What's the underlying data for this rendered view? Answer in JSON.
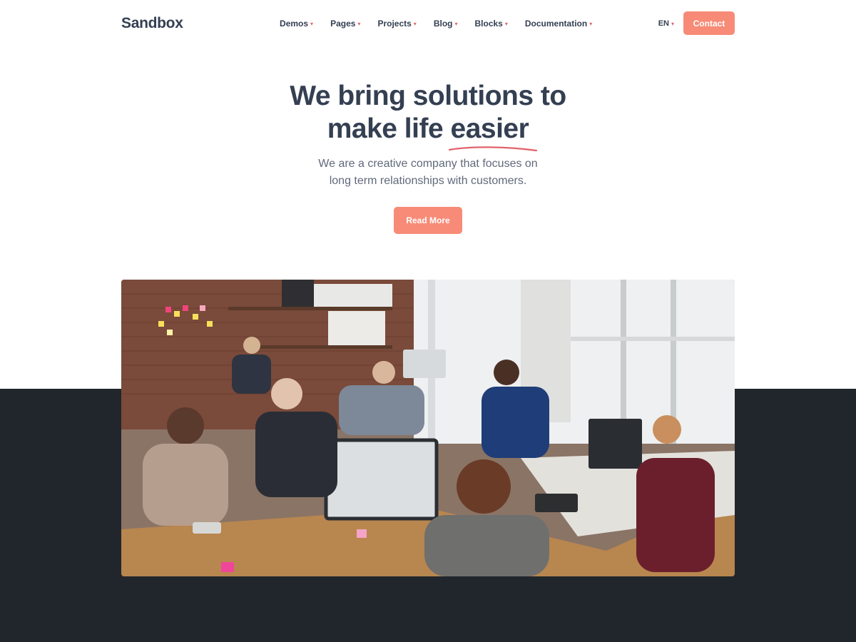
{
  "brand": {
    "logo_text": "Sandbox"
  },
  "nav": {
    "items": [
      {
        "label": "Demos"
      },
      {
        "label": "Pages"
      },
      {
        "label": "Projects"
      },
      {
        "label": "Blog"
      },
      {
        "label": "Blocks"
      },
      {
        "label": "Documentation"
      }
    ],
    "language": "EN",
    "contact_label": "Contact"
  },
  "hero": {
    "title_line1": "We bring solutions to",
    "title_line2_prefix": "make life ",
    "title_highlight": "easier",
    "subtitle_line1": "We are a creative company that focuses on",
    "subtitle_line2": "long term relationships with customers.",
    "cta_label": "Read More"
  },
  "colors": {
    "accent": "#f78b77",
    "text_dark": "#343f52",
    "text_muted": "#60697b",
    "dark_band": "#21262c"
  },
  "icons": {
    "dropdown": "chevron-down-icon"
  }
}
